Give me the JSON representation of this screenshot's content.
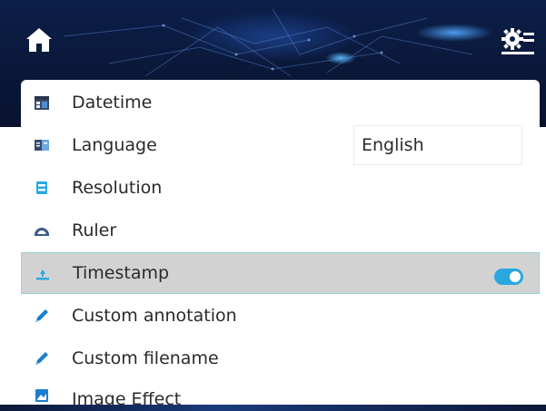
{
  "header": {
    "home_icon": "home-icon",
    "settings_icon": "settings-list-icon",
    "icon_color": "#ffffff"
  },
  "menu": {
    "items": [
      {
        "label": "Datetime",
        "icon": "calendar-icon"
      },
      {
        "label": "Language",
        "icon": "language-book-icon"
      },
      {
        "label": "Resolution",
        "icon": "resolution-icon"
      },
      {
        "label": "Ruler",
        "icon": "ruler-arc-icon"
      },
      {
        "label": "Timestamp",
        "icon": "timestamp-icon",
        "selected": true
      },
      {
        "label": "Custom annotation",
        "icon": "pencil-icon"
      },
      {
        "label": "Custom filename",
        "icon": "pencil-icon"
      },
      {
        "label": "Image Effect",
        "icon": "image-effect-icon"
      }
    ],
    "language_value": "English",
    "timestamp_enabled": true,
    "accent_color": "#29a8e0",
    "selected_bg": "#d2d2d2"
  }
}
